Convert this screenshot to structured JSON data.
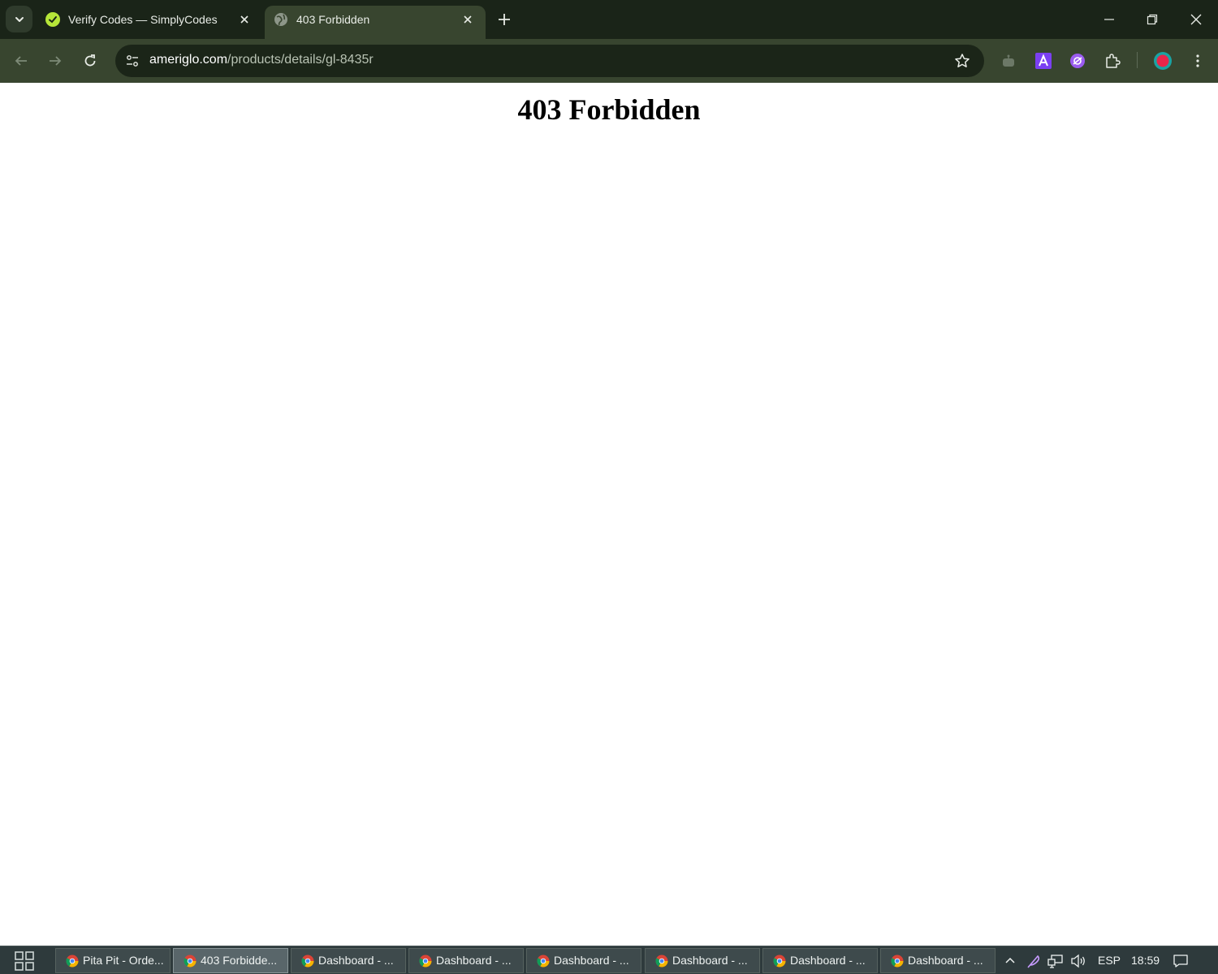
{
  "browser": {
    "tabs": [
      {
        "title": "Verify Codes — SimplyCodes",
        "favicon": "simplycodes-check-icon",
        "active": false
      },
      {
        "title": "403 Forbidden",
        "favicon": "globe-icon",
        "active": true
      }
    ],
    "address_bar": {
      "host": "ameriglo.com",
      "path": "/products/details/gl-8435r"
    },
    "extensions": [
      "robot-extension-icon",
      "a-extension-icon",
      "purple-extension-icon",
      "puzzle-extensions-icon",
      "profile-avatar"
    ]
  },
  "page": {
    "heading": "403 Forbidden"
  },
  "taskbar": {
    "items": [
      {
        "label": "Pita Pit - Orde...",
        "active": false
      },
      {
        "label": "403 Forbidde...",
        "active": true
      },
      {
        "label": "Dashboard - ...",
        "active": false
      },
      {
        "label": "Dashboard - ...",
        "active": false
      },
      {
        "label": "Dashboard - ...",
        "active": false
      },
      {
        "label": "Dashboard - ...",
        "active": false
      },
      {
        "label": "Dashboard - ...",
        "active": false
      },
      {
        "label": "Dashboard - ...",
        "active": false
      }
    ],
    "tray": {
      "language": "ESP",
      "time": "18:59"
    }
  },
  "colors": {
    "tabstrip_bg": "#1a2418",
    "toolbar_bg": "#38452f",
    "omnibox_bg": "#1b2518",
    "taskbar_bg": "#2e3a3c"
  }
}
